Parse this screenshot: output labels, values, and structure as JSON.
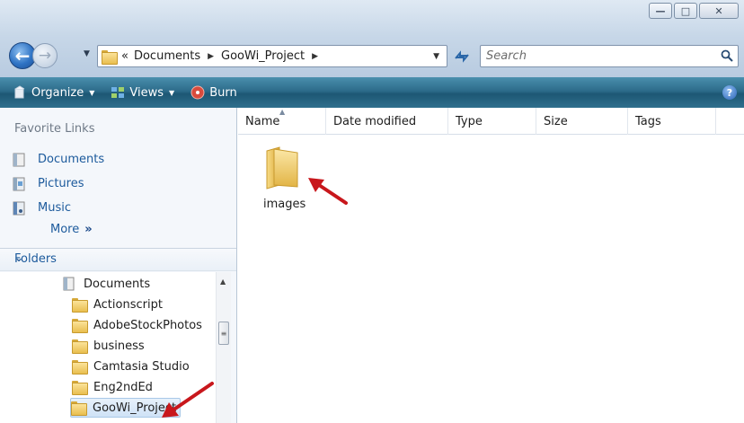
{
  "window": {
    "controls": {
      "minimize": "—",
      "maximize": "□",
      "close": "✕"
    }
  },
  "address": {
    "overflow": "«",
    "crumbs": [
      "Documents",
      "GooWi_Project"
    ],
    "search_placeholder": "Search"
  },
  "toolbar": {
    "organize": "Organize",
    "views": "Views",
    "burn": "Burn",
    "help": "?"
  },
  "favorites": {
    "heading": "Favorite Links",
    "items": [
      "Documents",
      "Pictures",
      "Music"
    ],
    "more": "More",
    "more_chevron": "»"
  },
  "folders": {
    "heading": "Folders",
    "tree": [
      "Documents",
      "Actionscript",
      "AdobeStockPhotos",
      "business",
      "Camtasia Studio",
      "Eng2ndEd",
      "GooWi_Project"
    ],
    "selected": "GooWi_Project"
  },
  "file_list": {
    "columns": [
      "Name",
      "Date modified",
      "Type",
      "Size",
      "Tags"
    ],
    "items": [
      {
        "name": "images",
        "kind": "folder"
      }
    ]
  },
  "colors": {
    "annotation_arrow": "#c8171c",
    "toolbar": "#1d5774",
    "link": "#1c5a9c"
  }
}
